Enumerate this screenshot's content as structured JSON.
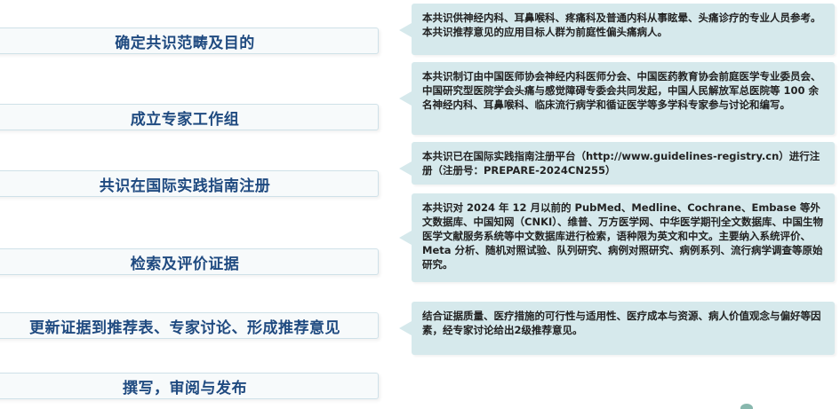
{
  "steps": [
    {
      "label": "确定共识范畴及目的"
    },
    {
      "label": "成立专家工作组"
    },
    {
      "label": "共识在国际实践指南注册"
    },
    {
      "label": "检索及评价证据"
    },
    {
      "label": "更新证据到推荐表、专家讨论、形成推荐意见"
    },
    {
      "label": "撰写，审阅与发布"
    }
  ],
  "notes": [
    {
      "text": "本共识供神经内科、耳鼻喉科、疼痛科及普通内科从事眩晕、头痛诊疗的专业人员参考。本共识推荐意见的应用目标人群为前庭性偏头痛病人。"
    },
    {
      "text": "本共识制订由中国医师协会神经内科医师分会、中国医药教育协会前庭医学专业委员会、中国研究型医院学会头痛与感觉障碍专委会共同发起，中国人民解放军总医院等 100 余名神经内科、耳鼻喉科、临床流行病学和循证医学等多学科专家参与讨论和编写。"
    },
    {
      "text": "本共识已在国际实践指南注册平台（http://www.guidelines-registry.cn）进行注册（注册号：PREPARE-2024CN255）"
    },
    {
      "text": "本共识对 2024 年 12 月以前的 PubMed、Medline、Cochrane、Embase 等外文数据库、中国知网（CNKI）、维普、万方医学网、中华医学期刊全文数据库、中国生物医学文献服务系统等中文数据库进行检索，语种限为英文和中文。主要纳入系统评价、Meta 分析、随机对照试验、队列研究、病例对照研究、病例系列、流行病学调查等原始研究。"
    },
    {
      "text": "结合证据质量、医疗措施的可行性与适用性、医疗成本与资源、病人价值观念与偏好等因素，经专家讨论给出2级推荐意见。"
    }
  ]
}
